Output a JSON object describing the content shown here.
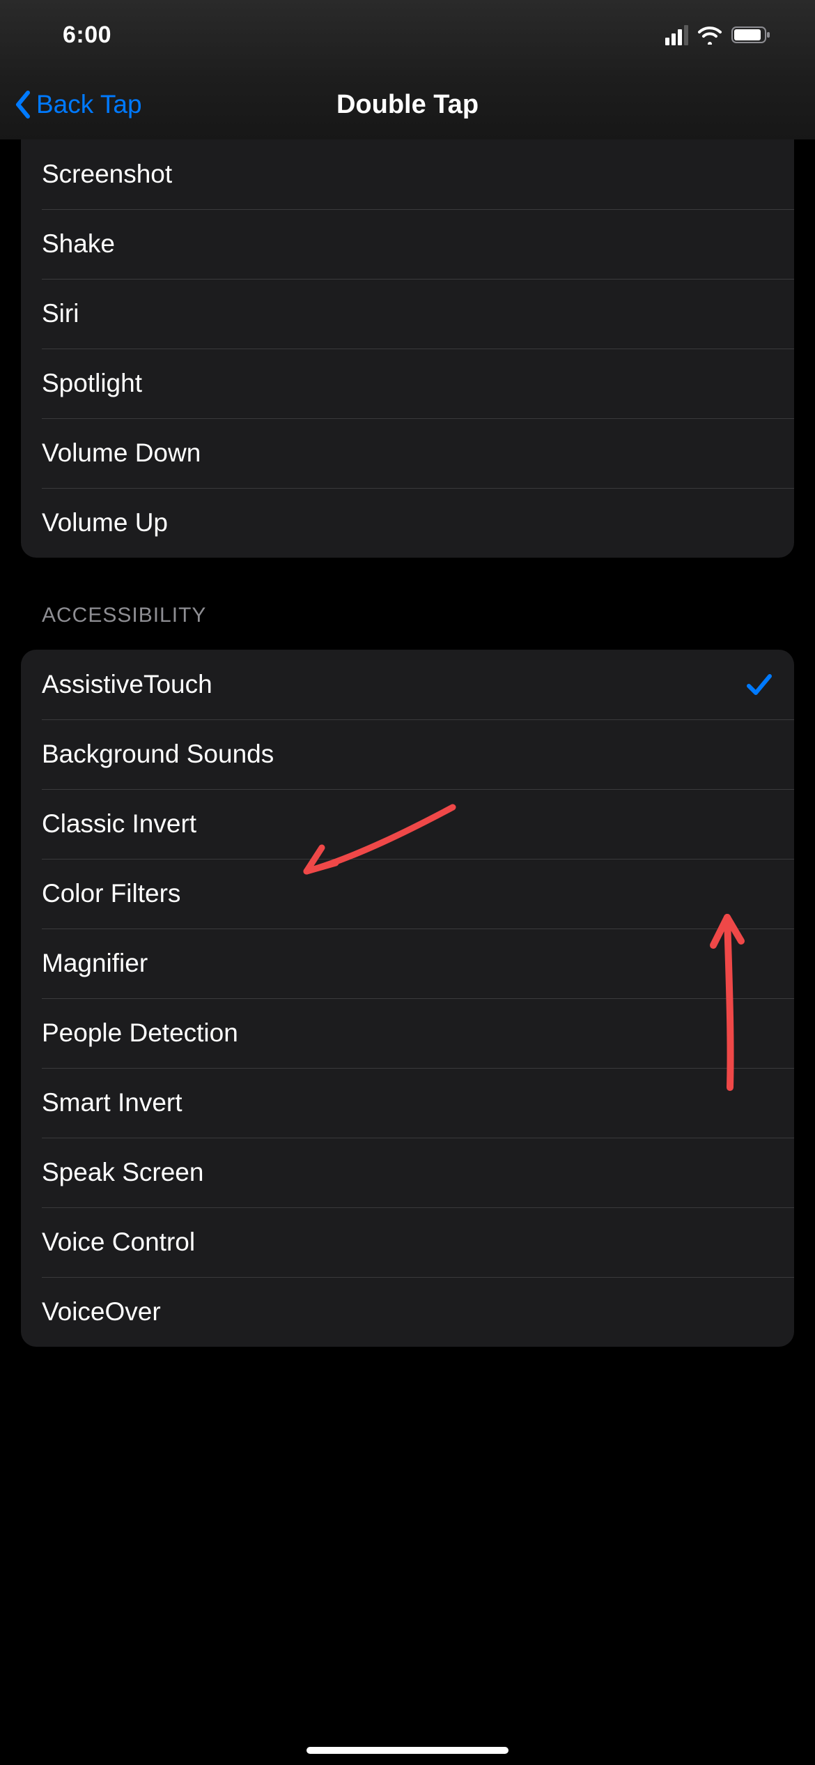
{
  "status": {
    "time": "6:00"
  },
  "nav": {
    "back_label": "Back Tap",
    "title": "Double Tap"
  },
  "group1": {
    "items": [
      {
        "label": "Screenshot",
        "checked": false
      },
      {
        "label": "Shake",
        "checked": false
      },
      {
        "label": "Siri",
        "checked": false
      },
      {
        "label": "Spotlight",
        "checked": false
      },
      {
        "label": "Volume Down",
        "checked": false
      },
      {
        "label": "Volume Up",
        "checked": false
      }
    ]
  },
  "section_accessibility": {
    "header": "ACCESSIBILITY",
    "items": [
      {
        "label": "AssistiveTouch",
        "checked": true
      },
      {
        "label": "Background Sounds",
        "checked": false
      },
      {
        "label": "Classic Invert",
        "checked": false
      },
      {
        "label": "Color Filters",
        "checked": false
      },
      {
        "label": "Magnifier",
        "checked": false
      },
      {
        "label": "People Detection",
        "checked": false
      },
      {
        "label": "Smart Invert",
        "checked": false
      },
      {
        "label": "Speak Screen",
        "checked": false
      },
      {
        "label": "Voice Control",
        "checked": false
      },
      {
        "label": "VoiceOver",
        "checked": false
      }
    ]
  },
  "colors": {
    "accent": "#007aff",
    "annotation": "#ef4848"
  }
}
